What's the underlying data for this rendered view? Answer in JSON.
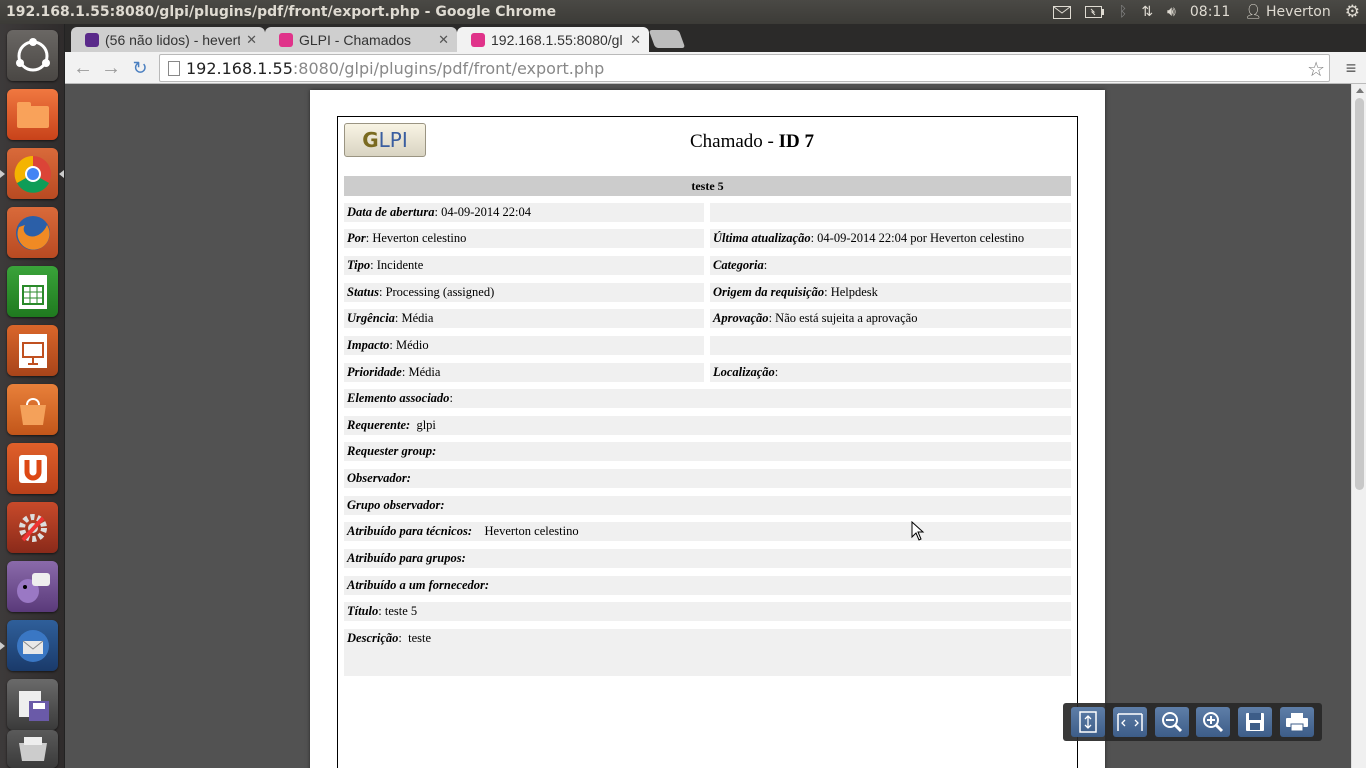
{
  "top_panel": {
    "window_title": "192.168.1.55:8080/glpi/plugins/pdf/front/export.php - Google Chrome",
    "clock": "08:11",
    "user": "Heverton"
  },
  "tabs": [
    {
      "title": "(56 não lidos) - hevert",
      "favicon": "mail-icon",
      "active": false
    },
    {
      "title": "GLPI - Chamados",
      "favicon": "glpi-icon",
      "active": false
    },
    {
      "title": "192.168.1.55:8080/gl",
      "favicon": "glpi-icon",
      "active": true
    }
  ],
  "toolbar": {
    "url_host": "192.168.1.55",
    "url_rest": ":8080/glpi/plugins/pdf/front/export.php"
  },
  "document": {
    "logo_text_g": "G",
    "logo_text_rest": "LPI",
    "title_prefix": "Chamado - ",
    "title_id": "ID 7",
    "section_title": "teste 5",
    "rows": {
      "data_abertura_label": "Data de abertura",
      "data_abertura_value": ": 04-09-2014 22:04",
      "por_label": "Por",
      "por_value": ": Heverton celestino",
      "ultima_label": "Última atualização",
      "ultima_value": ": 04-09-2014 22:04 por Heverton celestino",
      "tipo_label": "Tipo",
      "tipo_value": ": Incidente",
      "categoria_label": "Categoria",
      "categoria_value": ":",
      "status_label": "Status",
      "status_value": ": Processing (assigned)",
      "origem_label": "Origem da requisição",
      "origem_value": ": Helpdesk",
      "urgencia_label": "Urgência",
      "urgencia_value": ": Média",
      "aprovacao_label": "Aprovação",
      "aprovacao_value": ": Não está sujeita a aprovação",
      "impacto_label": "Impacto",
      "impacto_value": ": Médio",
      "prioridade_label": "Prioridade",
      "prioridade_value": ": Média",
      "localizacao_label": "Localização",
      "localizacao_value": ":",
      "elemento_label": "Elemento associado",
      "elemento_value": ":",
      "requerente_label": "Requerente:",
      "requerente_value": "glpi",
      "requester_group_label": "Requester group:",
      "observador_label": "Observador:",
      "grupo_observador_label": "Grupo observador:",
      "atribuido_tecnicos_label": "Atribuído para técnicos:",
      "atribuido_tecnicos_value": "Heverton celestino",
      "atribuido_grupos_label": "Atribuído para grupos:",
      "atribuido_fornecedor_label": "Atribuído a um fornecedor:",
      "titulo_label": "Título",
      "titulo_value": ": teste 5",
      "descricao_label": "Descrição",
      "descricao_value": "teste"
    }
  },
  "pdf_tools": [
    "fit-page-icon",
    "fit-width-icon",
    "zoom-out-icon",
    "zoom-in-icon",
    "save-icon",
    "print-icon"
  ]
}
